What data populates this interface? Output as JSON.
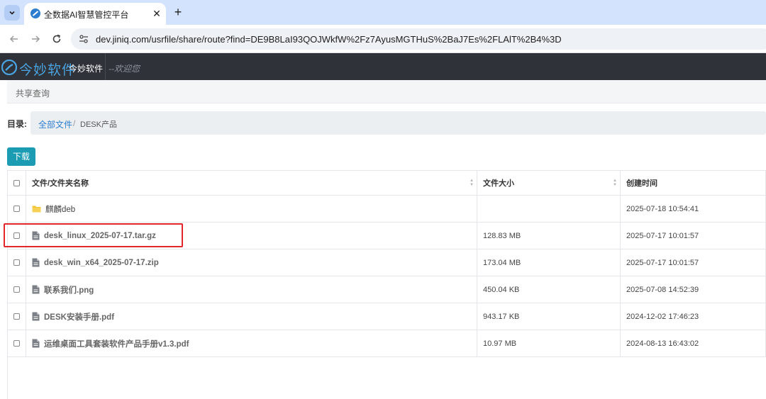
{
  "browser": {
    "tab_title": "全数据AI智慧管控平台",
    "url": "dev.jiniq.com/usrfile/share/route?find=DE9B8LaI93QOJWkfW%2Fz7AyusMGTHuS%2BaJ7Es%2FLAlT%2B4%3D"
  },
  "header": {
    "logo_text": "今妙软件",
    "brand": "今妙软件",
    "welcome": "--欢迎您"
  },
  "share_bar": {
    "label": "共享查询"
  },
  "breadcrumb": {
    "dir_label": "目录:",
    "root": "全部文件",
    "separator": "/",
    "current": "DESK产品"
  },
  "toolbar": {
    "download_label": "下载"
  },
  "table": {
    "headers": {
      "name": "文件/文件夹名称",
      "size": "文件大小",
      "created": "创建时间"
    },
    "rows": [
      {
        "type": "folder",
        "name": "麒麟deb",
        "size": "",
        "created": "2025-07-18 10:54:41"
      },
      {
        "type": "file",
        "name": "desk_linux_2025-07-17.tar.gz",
        "size": "128.83 MB",
        "created": "2025-07-17 10:01:57"
      },
      {
        "type": "file",
        "name": "desk_win_x64_2025-07-17.zip",
        "size": "173.04 MB",
        "created": "2025-07-17 10:01:57"
      },
      {
        "type": "file",
        "name": "联系我们.png",
        "size": "450.04 KB",
        "created": "2025-07-08 14:52:39"
      },
      {
        "type": "file",
        "name": "DESK安装手册.pdf",
        "size": "943.17 KB",
        "created": "2024-12-02 17:46:23"
      },
      {
        "type": "file",
        "name": "运维桌面工具套装软件产品手册v1.3.pdf",
        "size": "10.97 MB",
        "created": "2024-08-13 16:43:02"
      }
    ]
  },
  "colors": {
    "header_bg": "#2f3339",
    "accent": "#1b9cb3",
    "link": "#2d7ecf",
    "highlight": "#e3262b"
  }
}
